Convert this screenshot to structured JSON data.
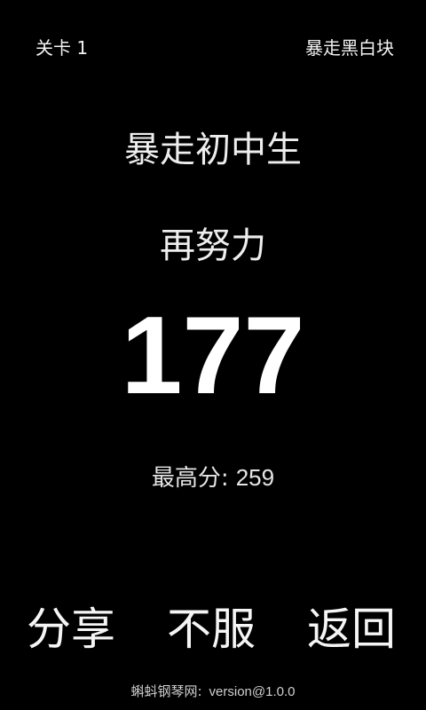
{
  "header": {
    "level_label": "关卡 1",
    "mode_label": "暴走黑白块"
  },
  "result": {
    "rank_title": "暴走初中生",
    "message": "再努力",
    "score": "177",
    "best_label": "最高分:",
    "best_value": "259"
  },
  "actions": {
    "share_label": "分享",
    "retry_label": "不服",
    "back_label": "返回"
  },
  "footer": {
    "site": "蝌蚪钢琴网:",
    "version": "version@1.0.0"
  },
  "colors": {
    "background": "#000000",
    "text": "#ffffff"
  }
}
